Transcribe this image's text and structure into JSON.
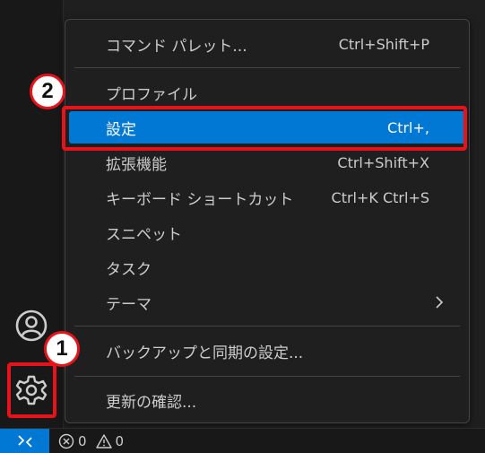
{
  "menu": {
    "items": [
      {
        "label": "コマンド パレット...",
        "shortcut": "Ctrl+Shift+P"
      },
      {
        "label": "プロファイル",
        "shortcut": ""
      },
      {
        "label": "設定",
        "shortcut": "Ctrl+,"
      },
      {
        "label": "拡張機能",
        "shortcut": "Ctrl+Shift+X"
      },
      {
        "label": "キーボード ショートカット",
        "shortcut": "Ctrl+K Ctrl+S"
      },
      {
        "label": "スニペット",
        "shortcut": ""
      },
      {
        "label": "タスク",
        "shortcut": ""
      },
      {
        "label": "テーマ",
        "shortcut": ""
      },
      {
        "label": "バックアップと同期の設定...",
        "shortcut": ""
      },
      {
        "label": "更新の確認...",
        "shortcut": ""
      }
    ],
    "active_item": "設定",
    "submenu_icon": "chevron-right-icon"
  },
  "activity_bar": {
    "account_icon": "account-icon",
    "manage_icon": "gear-icon"
  },
  "status_bar": {
    "remote_icon": "remote-icon",
    "error_icon": "error-icon",
    "errors": "0",
    "warning_icon": "warning-icon",
    "warnings": "0"
  },
  "annotations": {
    "badge_1": "1",
    "badge_2": "2"
  },
  "colors": {
    "accent": "#0078d4",
    "annotation_red": "#e8121a",
    "menu_bg": "#1f1f1f",
    "text": "#cccccc"
  }
}
